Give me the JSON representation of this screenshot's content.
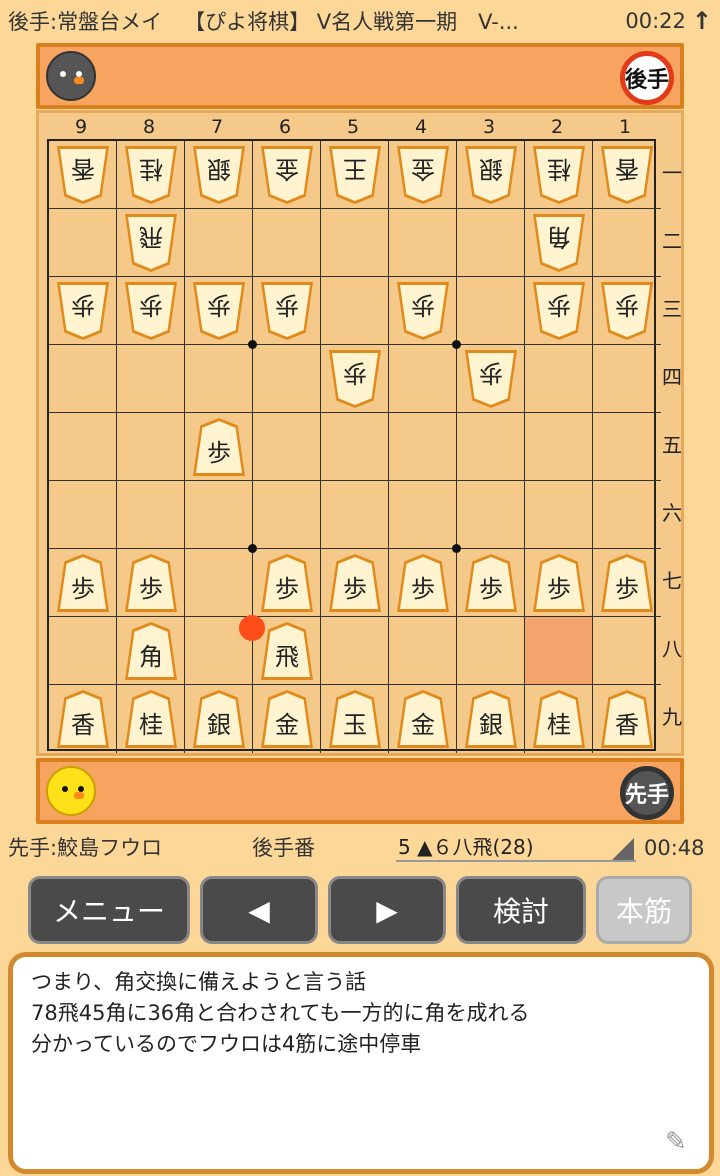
{
  "header": {
    "gote_player": "後手:常盤台メイ",
    "title": "【ぴよ将棋】 V名人戦第一期　V-...",
    "clock": "00:22",
    "up_icon": "↑"
  },
  "gote_stand": {
    "badge": "後手",
    "avatar": "black-chick-icon"
  },
  "sente_stand": {
    "badge": "先手",
    "avatar": "yellow-chick-icon"
  },
  "board": {
    "col_labels": [
      "9",
      "8",
      "7",
      "6",
      "5",
      "4",
      "3",
      "2",
      "1"
    ],
    "row_labels": [
      "一",
      "二",
      "三",
      "四",
      "五",
      "六",
      "七",
      "八",
      "九"
    ],
    "highlight": {
      "col": 2,
      "row": 8
    },
    "last_move_marker": {
      "col": 6,
      "row": 8
    },
    "pieces": [
      {
        "col": 9,
        "row": 1,
        "ch": "香",
        "owner": "gote"
      },
      {
        "col": 8,
        "row": 1,
        "ch": "桂",
        "owner": "gote"
      },
      {
        "col": 7,
        "row": 1,
        "ch": "銀",
        "owner": "gote"
      },
      {
        "col": 6,
        "row": 1,
        "ch": "金",
        "owner": "gote"
      },
      {
        "col": 5,
        "row": 1,
        "ch": "王",
        "owner": "gote"
      },
      {
        "col": 4,
        "row": 1,
        "ch": "金",
        "owner": "gote"
      },
      {
        "col": 3,
        "row": 1,
        "ch": "銀",
        "owner": "gote"
      },
      {
        "col": 2,
        "row": 1,
        "ch": "桂",
        "owner": "gote"
      },
      {
        "col": 1,
        "row": 1,
        "ch": "香",
        "owner": "gote"
      },
      {
        "col": 8,
        "row": 2,
        "ch": "飛",
        "owner": "gote"
      },
      {
        "col": 2,
        "row": 2,
        "ch": "角",
        "owner": "gote"
      },
      {
        "col": 9,
        "row": 3,
        "ch": "歩",
        "owner": "gote"
      },
      {
        "col": 8,
        "row": 3,
        "ch": "歩",
        "owner": "gote"
      },
      {
        "col": 7,
        "row": 3,
        "ch": "歩",
        "owner": "gote"
      },
      {
        "col": 6,
        "row": 3,
        "ch": "歩",
        "owner": "gote"
      },
      {
        "col": 4,
        "row": 3,
        "ch": "歩",
        "owner": "gote"
      },
      {
        "col": 2,
        "row": 3,
        "ch": "歩",
        "owner": "gote"
      },
      {
        "col": 1,
        "row": 3,
        "ch": "歩",
        "owner": "gote"
      },
      {
        "col": 5,
        "row": 4,
        "ch": "歩",
        "owner": "gote"
      },
      {
        "col": 3,
        "row": 4,
        "ch": "歩",
        "owner": "gote"
      },
      {
        "col": 7,
        "row": 5,
        "ch": "歩",
        "owner": "sente"
      },
      {
        "col": 9,
        "row": 7,
        "ch": "歩",
        "owner": "sente"
      },
      {
        "col": 8,
        "row": 7,
        "ch": "歩",
        "owner": "sente"
      },
      {
        "col": 6,
        "row": 7,
        "ch": "歩",
        "owner": "sente"
      },
      {
        "col": 5,
        "row": 7,
        "ch": "歩",
        "owner": "sente"
      },
      {
        "col": 4,
        "row": 7,
        "ch": "歩",
        "owner": "sente"
      },
      {
        "col": 3,
        "row": 7,
        "ch": "歩",
        "owner": "sente"
      },
      {
        "col": 2,
        "row": 7,
        "ch": "歩",
        "owner": "sente"
      },
      {
        "col": 1,
        "row": 7,
        "ch": "歩",
        "owner": "sente"
      },
      {
        "col": 8,
        "row": 8,
        "ch": "角",
        "owner": "sente"
      },
      {
        "col": 6,
        "row": 8,
        "ch": "飛",
        "owner": "sente"
      },
      {
        "col": 9,
        "row": 9,
        "ch": "香",
        "owner": "sente"
      },
      {
        "col": 8,
        "row": 9,
        "ch": "桂",
        "owner": "sente"
      },
      {
        "col": 7,
        "row": 9,
        "ch": "銀",
        "owner": "sente"
      },
      {
        "col": 6,
        "row": 9,
        "ch": "金",
        "owner": "sente"
      },
      {
        "col": 5,
        "row": 9,
        "ch": "玉",
        "owner": "sente"
      },
      {
        "col": 4,
        "row": 9,
        "ch": "金",
        "owner": "sente"
      },
      {
        "col": 3,
        "row": 9,
        "ch": "銀",
        "owner": "sente"
      },
      {
        "col": 2,
        "row": 9,
        "ch": "桂",
        "owner": "sente"
      },
      {
        "col": 1,
        "row": 9,
        "ch": "香",
        "owner": "sente"
      }
    ]
  },
  "footer": {
    "sente_player": "先手:鮫島フウロ",
    "turn": "後手番",
    "move": "5 ▲６八飛(28)",
    "clock": "00:48"
  },
  "buttons": {
    "menu": "メニュー",
    "prev": "◀",
    "next": "▶",
    "study": "検討",
    "mainline": "本筋"
  },
  "comment": [
    "つまり、角交換に備えようと言う話",
    "78飛45角に36角と合わされても一方的に角を成れる",
    "分かっているのでフウロは4筋に途中停車"
  ],
  "colors": {
    "background": "#fcd798",
    "stand": "#f7a460",
    "board": "#f5c98a",
    "highlight": "#f3a46c",
    "marker": "#ff4d1a"
  }
}
